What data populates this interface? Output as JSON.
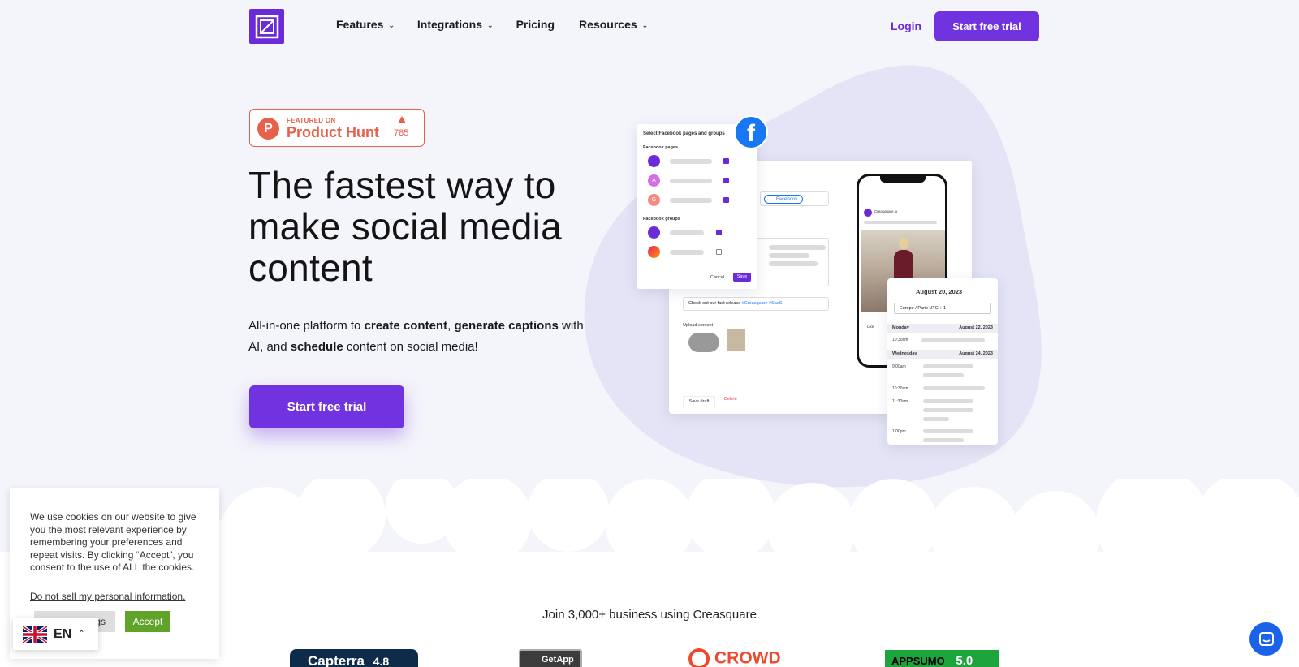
{
  "colors": {
    "brand": "#7132e0",
    "producthunt": "#e6604a",
    "facebook": "#1877f2",
    "accept": "#61a229",
    "chat": "#1a63e8"
  },
  "nav": {
    "logo_icon": "creasquare-logo-icon",
    "links": [
      {
        "label": "Features",
        "dropdown": true
      },
      {
        "label": "Integrations",
        "dropdown": true
      },
      {
        "label": "Pricing",
        "dropdown": false
      },
      {
        "label": "Resources",
        "dropdown": true
      }
    ],
    "login": "Login",
    "cta": "Start free trial"
  },
  "producthunt": {
    "featured": "FEATURED ON",
    "name": "Product Hunt",
    "votes": "785"
  },
  "hero": {
    "title": "The fastest way to make social media content",
    "sub_1": "All-in-one platform to ",
    "sub_b1": "create content",
    "sub_2": ", ",
    "sub_b2": "generate captions",
    "sub_3": " with AI, and ",
    "sub_b3": "schedule",
    "sub_4": " content on social media!",
    "cta": "Start free trial"
  },
  "mock": {
    "panel_title": "Select Facebook pages and groups",
    "pages_label": "Facebook pages",
    "groups_label": "Facebook groups",
    "page_avatars": [
      "A",
      "G"
    ],
    "cancel": "Cancel",
    "save": "Save",
    "network_chip": "Facebook",
    "editor_text": "Check out our fast release ",
    "editor_tags": "#Creasquare #SaaS",
    "upload_label": "Upload content",
    "save_draft": "Save draft",
    "delete": "Delete",
    "phone_author": "Creasquare.io",
    "phone_like": "Like",
    "schedule_date": "August 20, 2023",
    "timezone": "Europe / Paris UTC + 1",
    "day1": "Monday",
    "day1_date": "August 22, 2023",
    "day2": "Wednesday",
    "day2_date": "August 24, 2023",
    "times": [
      "10:30am",
      "9:00am",
      "10:30am",
      "11:30am",
      "1:00pm"
    ]
  },
  "join": "Join 3,000+ business using Creasquare",
  "review_logos": {
    "capterra": "Capterra",
    "capterra_score": "4.8",
    "getapp": "GetApp",
    "g2": "CROWD",
    "appsumo": "APPSUMO",
    "appsumo_score": "5.0"
  },
  "cookie": {
    "text": "We use cookies on our website to give you the most relevant experience by remembering your preferences and repeat visits. By clicking “Accept”, you consent to the use of ALL the cookies.",
    "link": "Do not sell my personal information",
    "link_suffix": ".",
    "settings": "gs",
    "accept": "Accept"
  },
  "language": {
    "code": "EN",
    "flag": "uk-flag-icon"
  }
}
